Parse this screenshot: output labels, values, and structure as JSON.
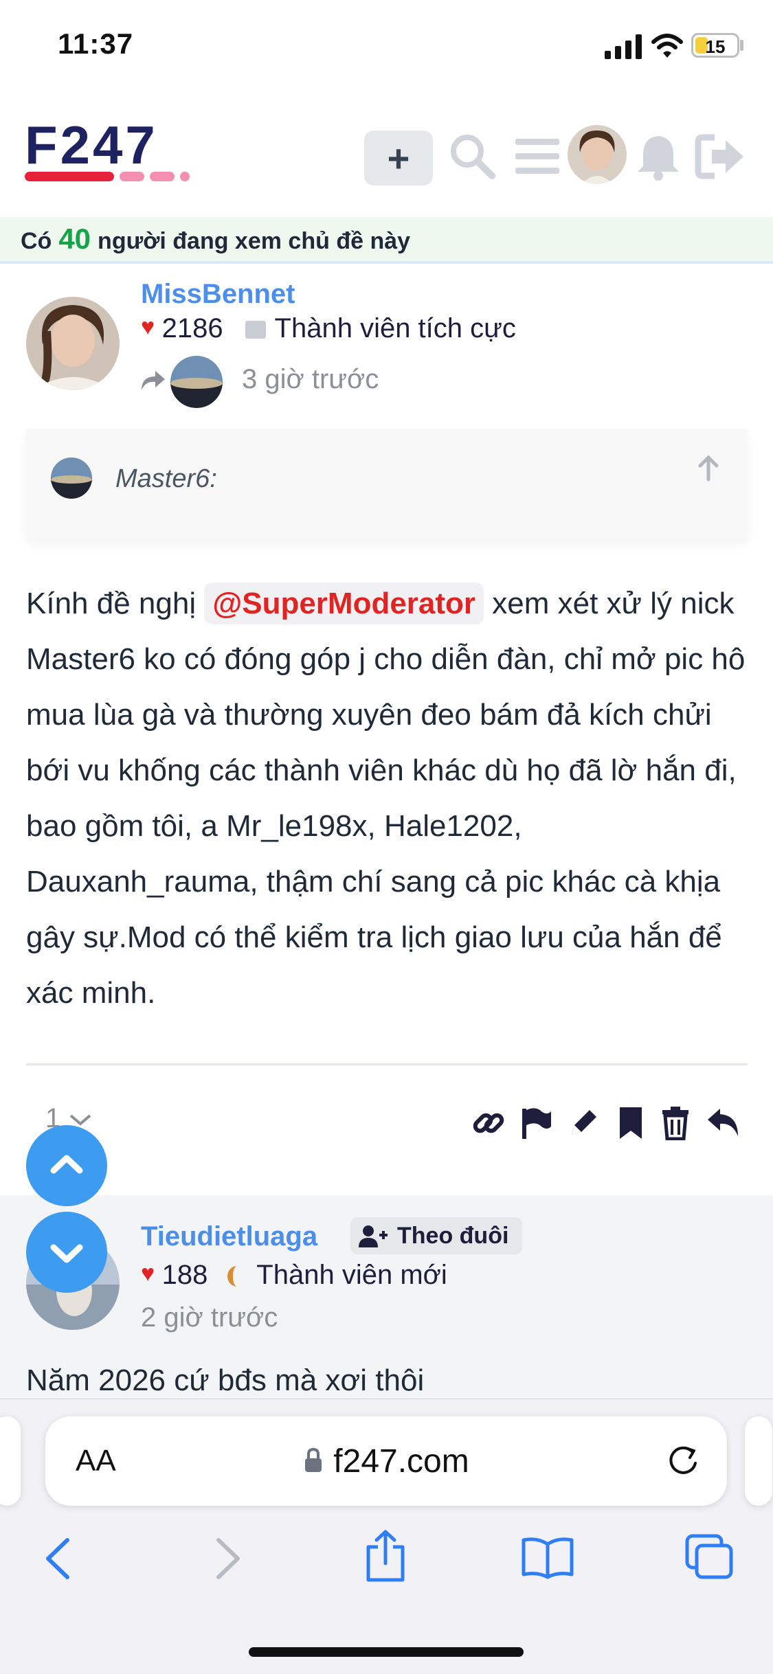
{
  "status_bar": {
    "time": "11:37",
    "battery": "15"
  },
  "header": {
    "logo_text": "F247",
    "add_label": "+"
  },
  "viewers_banner": {
    "prefix": "Có",
    "count": "40",
    "suffix": "người đang xem chủ đề này"
  },
  "post1": {
    "username": "MissBennet",
    "likes": "2186",
    "rank": "Thành viên tích cực",
    "time": "3 giờ trước",
    "quote_author": "Master6:",
    "body_before": "Kính đề nghị ",
    "mention": "@SuperModerator",
    "body_after": " xem xét xử lý nick Master6 ko có đóng góp j cho diễn đàn, chỉ mở pic hô mua lùa gà và thường xuyên đeo bám đả kích chửi bới vu khống các thành viên khác dù họ đã lờ hắn đi, bao gồm tôi, a Mr_le198x, Hale1202, Dauxanh_rauma, thậm chí sang cả pic khác cà khịa gây sự.Mod có thể kiểm tra lịch giao lưu của hắn để xác minh.",
    "reply_count": "1"
  },
  "post2": {
    "username": "Tieudietluaga",
    "follow_label": "Theo đuôi",
    "likes": "188",
    "rank": "Thành viên mới",
    "time": "2 giờ trước",
    "body": "Năm 2026 cứ bđs mà xơi thôi"
  },
  "safari": {
    "text_size": "AA",
    "url": "f247.com"
  },
  "colors": {
    "accent_blue": "#4d8ee8",
    "fab_blue": "#3d9bf0",
    "heart_red": "#e02424",
    "logo_navy": "#1e2260",
    "logo_red": "#e8213a",
    "logo_pink": "#f48fb1",
    "count_green": "#16a34a"
  }
}
